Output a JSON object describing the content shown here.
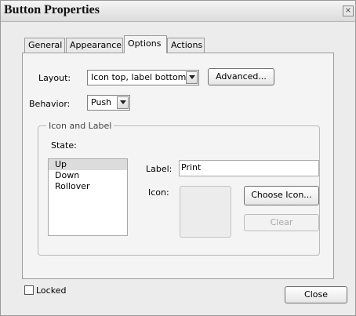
{
  "window": {
    "title": "Button Properties",
    "close_glyph": "×"
  },
  "tabs": [
    {
      "label": "General",
      "active": false
    },
    {
      "label": "Appearance",
      "active": false
    },
    {
      "label": "Options",
      "active": true
    },
    {
      "label": "Actions",
      "active": false
    }
  ],
  "layout": {
    "label": "Layout:",
    "value": "Icon top, label bottom",
    "advanced_button": "Advanced..."
  },
  "behavior": {
    "label": "Behavior:",
    "value": "Push"
  },
  "icon_and_label": {
    "legend": "Icon and Label",
    "state_label": "State:",
    "states": [
      "Up",
      "Down",
      "Rollover"
    ],
    "selected_state": "Up",
    "label_field_label": "Label:",
    "label_value": "Print",
    "icon_label": "Icon:",
    "choose_icon_button": "Choose Icon...",
    "clear_button": "Clear"
  },
  "footer": {
    "locked_label": "Locked",
    "locked": false,
    "close_button": "Close"
  },
  "icons": {
    "dropdown": "chevron-down-icon",
    "close": "close-icon"
  }
}
